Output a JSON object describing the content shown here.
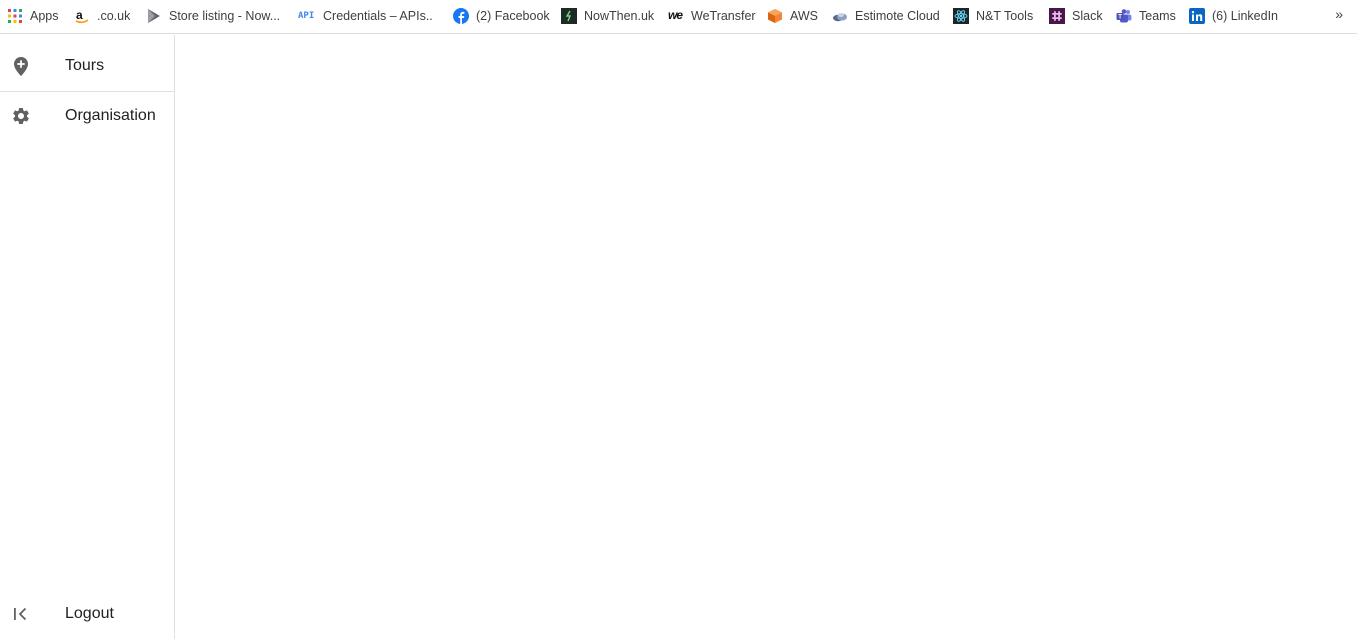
{
  "bookmarks": {
    "items": [
      {
        "label": "Apps",
        "icon": "apps-grid-icon"
      },
      {
        "label": ".co.uk",
        "icon": "amazon-icon"
      },
      {
        "label": "Store listing - Now...",
        "icon": "play-store-icon"
      },
      {
        "label": "Credentials – APIs...",
        "icon": "api-icon"
      },
      {
        "label": "(2) Facebook",
        "icon": "facebook-icon"
      },
      {
        "label": "NowThen.uk",
        "icon": "nowthen-icon"
      },
      {
        "label": "WeTransfer",
        "icon": "wetransfer-icon"
      },
      {
        "label": "AWS",
        "icon": "aws-icon"
      },
      {
        "label": "Estimote Cloud",
        "icon": "estimote-icon"
      },
      {
        "label": "N&T Tools",
        "icon": "react-icon"
      },
      {
        "label": "Slack",
        "icon": "slack-icon"
      },
      {
        "label": "Teams",
        "icon": "teams-icon"
      },
      {
        "label": "(6) LinkedIn",
        "icon": "linkedin-icon"
      }
    ],
    "more": "»",
    "api_badge": "API",
    "we_badge": "we"
  },
  "sidebar": {
    "items": [
      {
        "label": "Tours",
        "icon": "map-pin-add-icon"
      },
      {
        "label": "Organisation",
        "icon": "gear-icon"
      }
    ],
    "logout": {
      "label": "Logout",
      "icon": "collapse-left-icon"
    }
  },
  "colors": {
    "text": "#212121",
    "icon": "#616161",
    "border": "#e0e0e0",
    "facebook": "#1877f2",
    "aws": "#f58536",
    "linkedin": "#0a66c2",
    "slack": "#4a154b",
    "teams": "#5059c9"
  }
}
